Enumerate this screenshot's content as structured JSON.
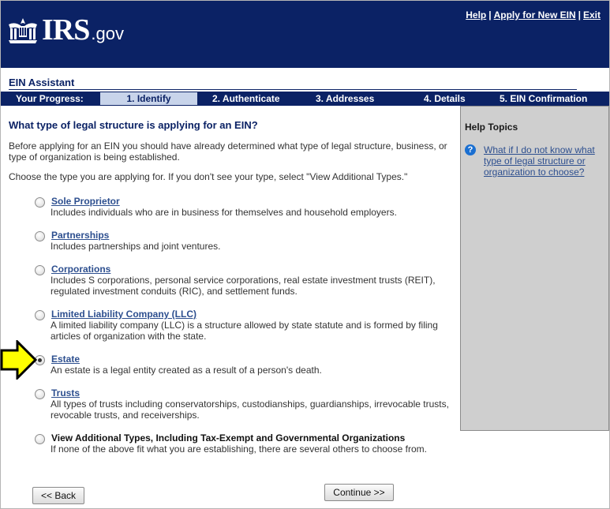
{
  "header": {
    "logo_text": "IRS",
    "logo_suffix": ".gov",
    "links": {
      "help": "Help",
      "sep1": "|",
      "apply": "Apply for New EIN",
      "sep2": "|",
      "exit": "Exit"
    }
  },
  "assistant_title": "EIN Assistant",
  "progress": {
    "label": "Your Progress:",
    "steps": [
      "1. Identify",
      "2. Authenticate",
      "3. Addresses",
      "4. Details",
      "5. EIN Confirmation"
    ],
    "active_step": 0
  },
  "main": {
    "question": "What type of legal structure is applying for an EIN?",
    "intro": "Before applying for an EIN you should have already determined what type of legal structure, business, or type of organization is being established.",
    "choose": "Choose the type you are applying for. If you don't see your type, select \"View Additional Types.\"",
    "options": [
      {
        "label": "Sole Proprietor",
        "desc": "Includes individuals who are in business for themselves and household employers."
      },
      {
        "label": "Partnerships",
        "desc": "Includes partnerships and joint ventures."
      },
      {
        "label": "Corporations",
        "desc": "Includes S corporations, personal service corporations, real estate investment trusts (REIT), regulated investment conduits (RIC), and settlement funds."
      },
      {
        "label": "Limited Liability Company (LLC)",
        "desc": "A limited liability company (LLC) is a structure allowed by state statute and is formed by filing articles of organization with the state."
      },
      {
        "label": "Estate",
        "desc": "An estate is a legal entity created as a result of a person's death."
      },
      {
        "label": "Trusts",
        "desc": "All types of trusts including conservatorships, custodianships, guardianships, irrevocable trusts, revocable trusts, and receiverships."
      },
      {
        "label": "View Additional Types, Including Tax-Exempt and Governmental Organizations",
        "desc": "If none of the above fit what you are establishing, there are several others to choose from."
      }
    ],
    "selected_option": "Estate"
  },
  "help_panel": {
    "title": "Help Topics",
    "icon": "question-icon",
    "link": "What if I do not know what type of legal structure or organization to choose?"
  },
  "buttons": {
    "back": "<< Back",
    "continue": "Continue >>"
  },
  "colors": {
    "header_bg": "#0b2265",
    "active_step_bg": "#c8d4ea",
    "link": "#2d4f8f",
    "help_bg": "#cfcfcf",
    "arrow": "#ffff00"
  }
}
